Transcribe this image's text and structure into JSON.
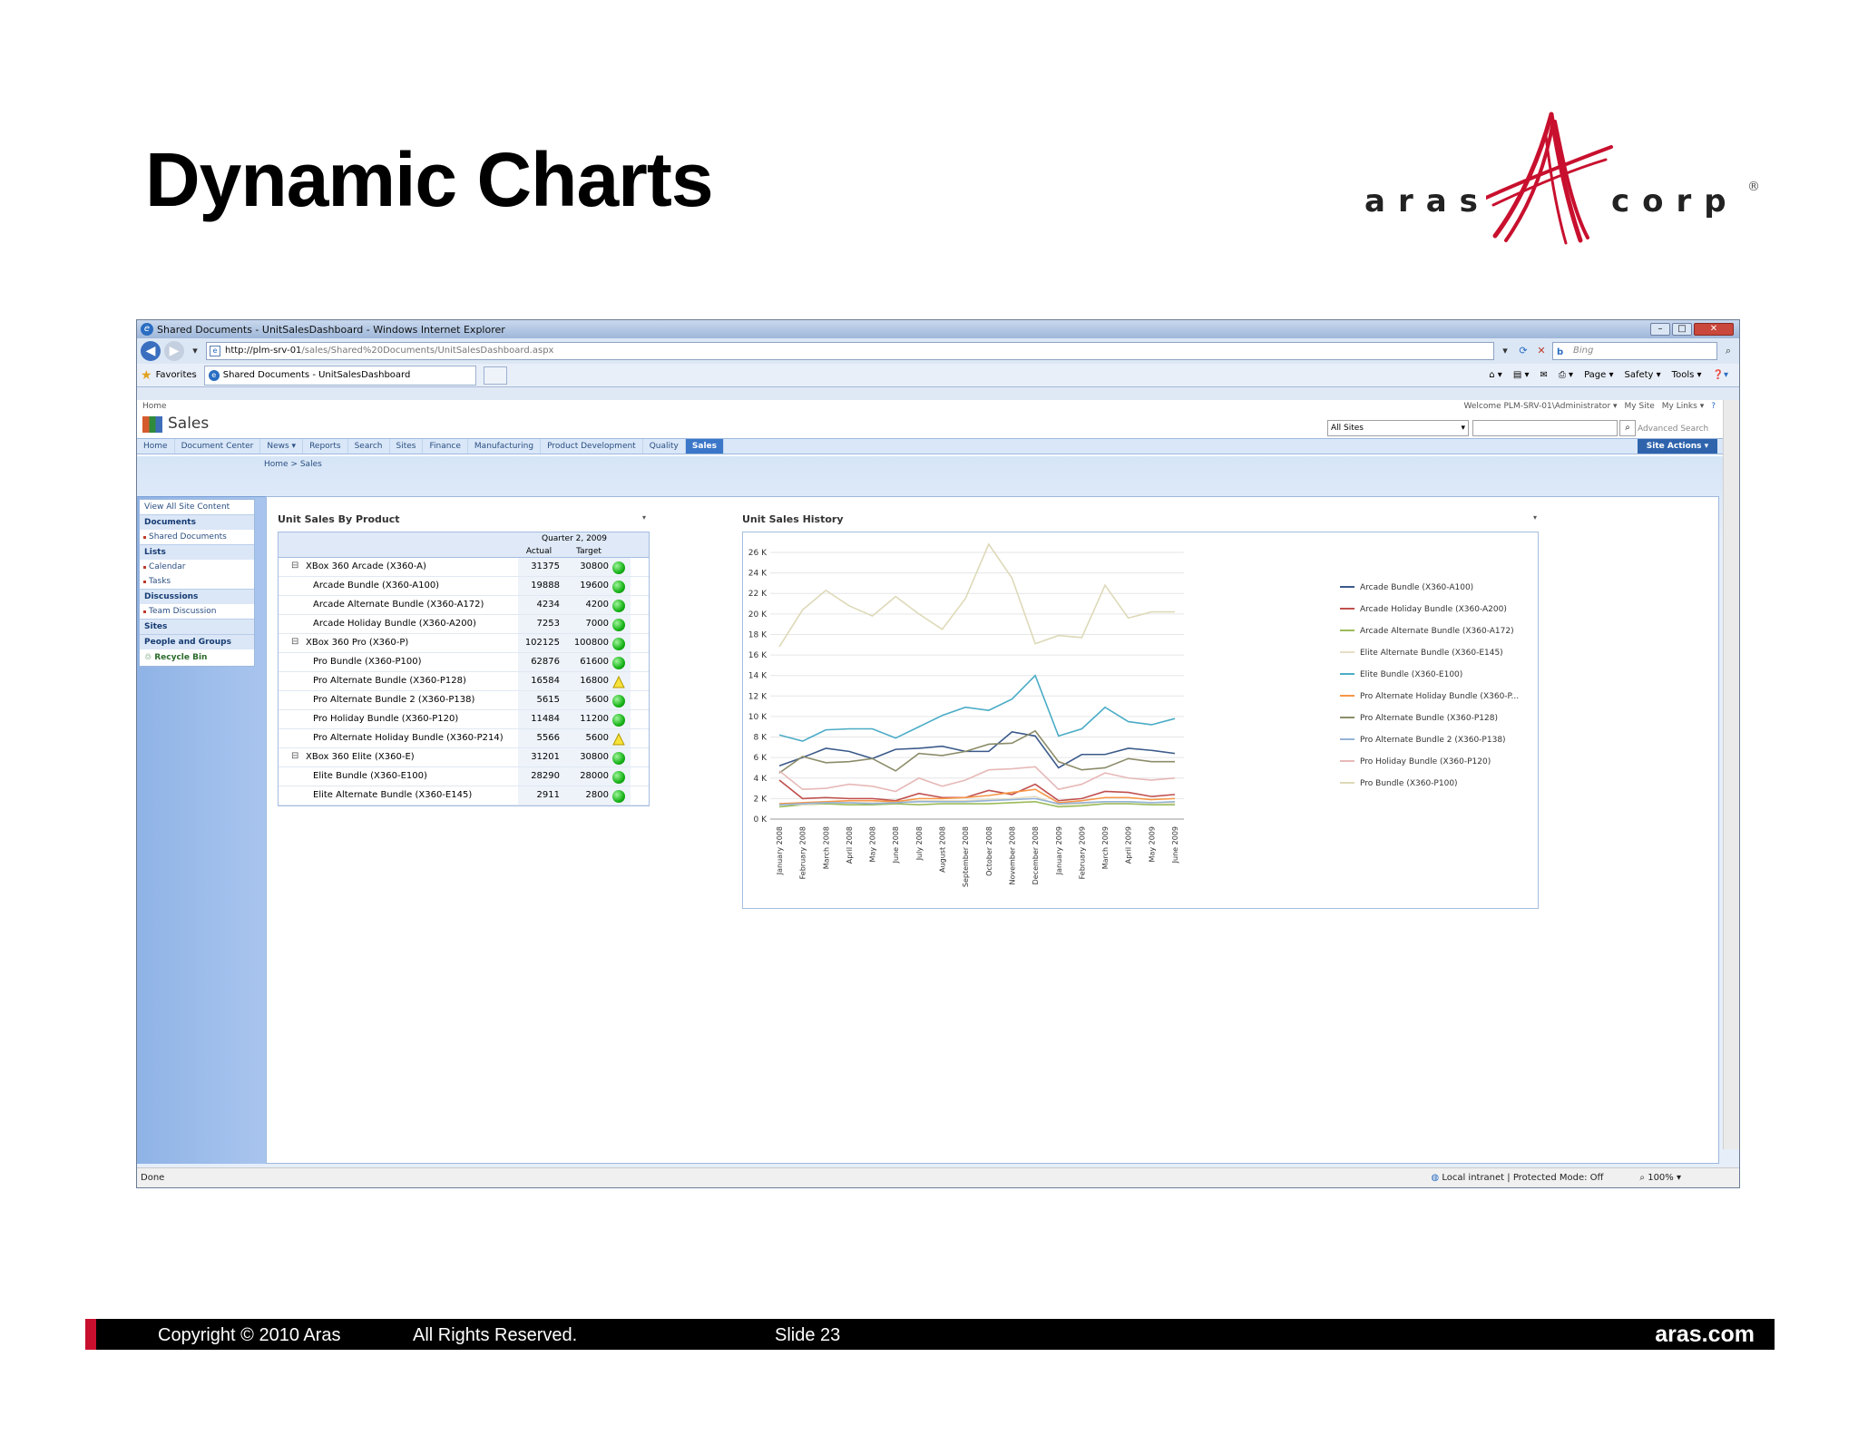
{
  "slide": {
    "title": "Dynamic Charts",
    "logo": {
      "left_word": "aras",
      "right_word": "corp",
      "registered": "®"
    },
    "footer": {
      "copyright": "Copyright © 2010 Aras",
      "rights": "All Rights Reserved.",
      "slide_number": "Slide 23",
      "site": "aras.com"
    }
  },
  "browser": {
    "window_title": "Shared Documents - UnitSalesDashboard - Windows Internet Explorer",
    "url_host": "http://plm-srv-01",
    "url_path": "/sales/Shared%20Documents/UnitSalesDashboard.aspx",
    "search_placeholder": "Bing",
    "favorites_label": "Favorites",
    "tab_label": "Shared Documents - UnitSalesDashboard",
    "commands": [
      "Page ▾",
      "Safety ▾",
      "Tools ▾"
    ],
    "status_left": "Done",
    "status_zone": "Local intranet | Protected Mode: Off",
    "zoom": "100%"
  },
  "sharepoint": {
    "top_home": "Home",
    "welcome": "Welcome PLM-SRV-01\\Administrator ▾",
    "my_site": "My Site",
    "my_links": "My Links ▾",
    "site_name": "Sales",
    "search_scope": "All Sites",
    "advanced_search": "Advanced Search",
    "site_actions": "Site Actions ▾",
    "nav_tabs": [
      "Home",
      "Document Center",
      "News ▾",
      "Reports",
      "Search",
      "Sites",
      "Finance",
      "Manufacturing",
      "Product Development",
      "Quality",
      "Sales"
    ],
    "active_tab": "Sales",
    "breadcrumb": "Home > Sales",
    "quick_launch": {
      "view_all": "View All Site Content",
      "documents": "Documents",
      "shared_documents": "Shared Documents",
      "lists": "Lists",
      "calendar": "Calendar",
      "tasks": "Tasks",
      "discussions": "Discussions",
      "team_discussion": "Team Discussion",
      "sites": "Sites",
      "people_groups": "People and Groups",
      "recycle_bin": "Recycle Bin"
    }
  },
  "sales_by_product": {
    "title": "Unit Sales By Product",
    "period": "Quarter 2, 2009",
    "col_actual": "Actual",
    "col_target": "Target",
    "rows": [
      {
        "name": "XBox 360 Arcade (X360-A)",
        "group": true,
        "actual": "31375",
        "target": "30800",
        "status": "green"
      },
      {
        "name": "Arcade Bundle (X360-A100)",
        "group": false,
        "actual": "19888",
        "target": "19600",
        "status": "green"
      },
      {
        "name": "Arcade Alternate Bundle (X360-A172)",
        "group": false,
        "actual": "4234",
        "target": "4200",
        "status": "green"
      },
      {
        "name": "Arcade Holiday Bundle (X360-A200)",
        "group": false,
        "actual": "7253",
        "target": "7000",
        "status": "green"
      },
      {
        "name": "XBox 360 Pro (X360-P)",
        "group": true,
        "actual": "102125",
        "target": "100800",
        "status": "green"
      },
      {
        "name": "Pro Bundle (X360-P100)",
        "group": false,
        "actual": "62876",
        "target": "61600",
        "status": "green"
      },
      {
        "name": "Pro Alternate Bundle (X360-P128)",
        "group": false,
        "actual": "16584",
        "target": "16800",
        "status": "yellow"
      },
      {
        "name": "Pro Alternate Bundle 2 (X360-P138)",
        "group": false,
        "actual": "5615",
        "target": "5600",
        "status": "green"
      },
      {
        "name": "Pro Holiday Bundle (X360-P120)",
        "group": false,
        "actual": "11484",
        "target": "11200",
        "status": "green"
      },
      {
        "name": "Pro Alternate Holiday Bundle (X360-P214)",
        "group": false,
        "actual": "5566",
        "target": "5600",
        "status": "yellow"
      },
      {
        "name": "XBox 360 Elite (X360-E)",
        "group": true,
        "actual": "31201",
        "target": "30800",
        "status": "green"
      },
      {
        "name": "Elite Bundle (X360-E100)",
        "group": false,
        "actual": "28290",
        "target": "28000",
        "status": "green"
      },
      {
        "name": "Elite Alternate Bundle (X360-E145)",
        "group": false,
        "actual": "2911",
        "target": "2800",
        "status": "green"
      }
    ]
  },
  "chart_data": {
    "type": "line",
    "title": "Unit Sales History",
    "xlabel": "",
    "ylabel": "",
    "ylim": [
      0,
      26000
    ],
    "y_ticks": [
      "0 K",
      "2 K",
      "4 K",
      "6 K",
      "8 K",
      "10 K",
      "12 K",
      "14 K",
      "16 K",
      "18 K",
      "20 K",
      "22 K",
      "24 K",
      "26 K"
    ],
    "legend_position": "right",
    "grid": true,
    "categories": [
      "January 2008",
      "February 2008",
      "March 2008",
      "April 2008",
      "May 2008",
      "June 2008",
      "July 2008",
      "August 2008",
      "September 2008",
      "October 2008",
      "November 2008",
      "December 2008",
      "January 2009",
      "February 2009",
      "March 2009",
      "April 2009",
      "May 2009",
      "June 2009"
    ],
    "series": [
      {
        "name": "Arcade Bundle (X360-A100)",
        "color": "#3b5a8a",
        "values": [
          5200,
          6000,
          6900,
          6600,
          5900,
          6800,
          6900,
          7100,
          6600,
          6600,
          8500,
          8100,
          5000,
          6300,
          6300,
          6900,
          6700,
          6400
        ]
      },
      {
        "name": "Arcade Holiday Bundle (X360-A200)",
        "color": "#c0504d",
        "values": [
          3800,
          2000,
          2100,
          2000,
          2000,
          1800,
          2500,
          2100,
          2100,
          2800,
          2400,
          3400,
          1800,
          2000,
          2700,
          2600,
          2200,
          2400
        ]
      },
      {
        "name": "Arcade Alternate Bundle (X360-A172)",
        "color": "#9bbb59",
        "values": [
          1200,
          1400,
          1500,
          1400,
          1400,
          1500,
          1400,
          1500,
          1500,
          1500,
          1600,
          1700,
          1200,
          1300,
          1500,
          1500,
          1400,
          1400
        ]
      },
      {
        "name": "Elite Alternate Bundle (X360-E145)",
        "color": "#e6dfc4",
        "values": [
          1500,
          1400,
          1600,
          1600,
          1600,
          1600,
          1800,
          1800,
          1800,
          1900,
          2000,
          2200,
          1400,
          1500,
          1700,
          1700,
          1600,
          1600
        ]
      },
      {
        "name": "Elite Bundle (X360-E100)",
        "color": "#4bacc6",
        "values": [
          8200,
          7600,
          8700,
          8800,
          8800,
          7900,
          9000,
          10100,
          10900,
          10600,
          11700,
          14000,
          8100,
          8800,
          10900,
          9500,
          9200,
          9800
        ]
      },
      {
        "name": "Pro Alternate Holiday Bundle (X360-P...",
        "color": "#f79646",
        "values": [
          1500,
          1600,
          1700,
          1800,
          1800,
          1700,
          2000,
          2000,
          2100,
          2300,
          2600,
          2900,
          1600,
          1800,
          2100,
          2100,
          1900,
          2000
        ]
      },
      {
        "name": "Pro Alternate Bundle (X360-P128)",
        "color": "#8c8c6a",
        "values": [
          4500,
          6100,
          5500,
          5600,
          5900,
          4700,
          6400,
          6200,
          6600,
          7300,
          7400,
          8600,
          5600,
          4800,
          5000,
          5900,
          5600,
          5600
        ]
      },
      {
        "name": "Pro Alternate Bundle 2 (X360-P138)",
        "color": "#95b3d7",
        "values": [
          1400,
          1500,
          1600,
          1600,
          1500,
          1600,
          1700,
          1700,
          1700,
          1800,
          1900,
          2000,
          1500,
          1600,
          1700,
          1700,
          1600,
          1700
        ]
      },
      {
        "name": "Pro Holiday Bundle (X360-P120)",
        "color": "#e6b9b8",
        "values": [
          4700,
          2900,
          3000,
          3400,
          3200,
          2700,
          4000,
          3200,
          3800,
          4800,
          4900,
          5100,
          2900,
          3400,
          4500,
          4000,
          3800,
          4000
        ]
      },
      {
        "name": "Pro Bundle (X360-P100)",
        "color": "#ddd9b8",
        "values": [
          16800,
          20400,
          22300,
          20800,
          19800,
          21700,
          20000,
          18500,
          21500,
          26800,
          23500,
          17100,
          17900,
          17700,
          22800,
          19600,
          20200,
          20200
        ]
      }
    ]
  }
}
